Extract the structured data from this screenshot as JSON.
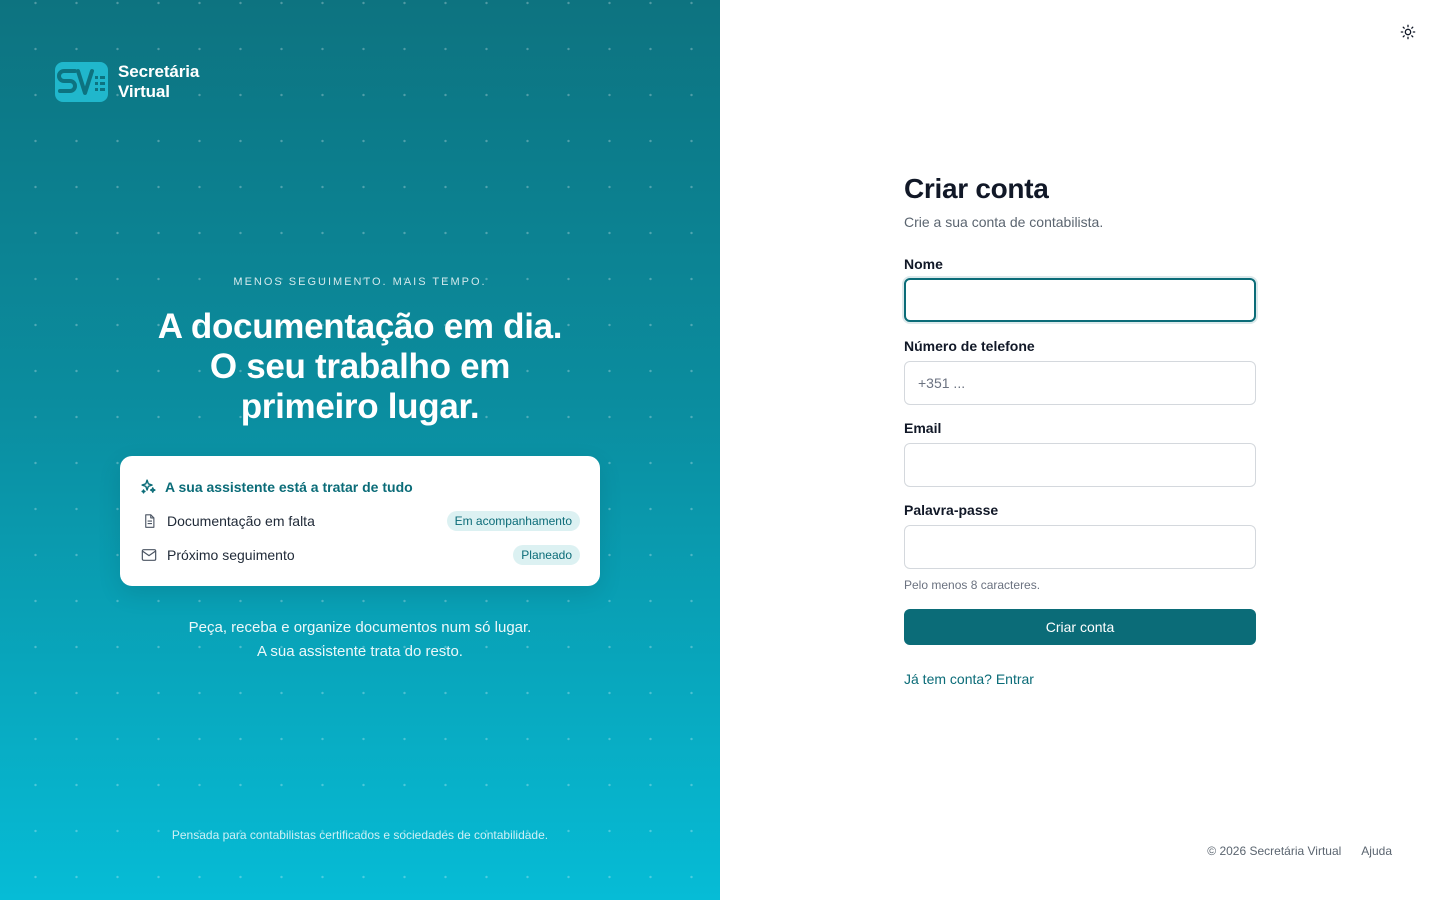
{
  "brand": {
    "name_line1": "Secretária",
    "name_line2": "Virtual",
    "logo_icon": "sv-logo-icon"
  },
  "hero": {
    "eyebrow": "MENOS SEGUIMENTO. MAIS TEMPO.",
    "headline_line1": "A documentação em dia.",
    "headline_line2": "O seu trabalho em",
    "headline_line3": "primeiro lugar.",
    "subtext_line1": "Peça, receba e organize documentos num só lugar.",
    "subtext_line2": "A sua assistente trata do resto.",
    "footnote": "Pensada para contabilistas certificados e sociedades de contabilidade."
  },
  "card": {
    "title": "A sua assistente está a tratar de tudo",
    "rows": [
      {
        "label": "Documentação em falta",
        "badge": "Em acompanhamento",
        "icon": "document-icon"
      },
      {
        "label": "Próximo seguimento",
        "badge": "Planeado",
        "icon": "mail-icon"
      }
    ]
  },
  "form": {
    "title": "Criar conta",
    "subtitle": "Crie a sua conta de contabilista.",
    "fields": {
      "name": {
        "label": "Nome",
        "value": "",
        "placeholder": ""
      },
      "phone": {
        "label": "Número de telefone",
        "value": "",
        "placeholder": "+351 ..."
      },
      "email": {
        "label": "Email",
        "value": "",
        "placeholder": ""
      },
      "password": {
        "label": "Palavra-passe",
        "value": "",
        "placeholder": "",
        "hint": "Pelo menos 8 caracteres."
      }
    },
    "submit_label": "Criar conta",
    "login_link": "Já tem conta? Entrar"
  },
  "footer": {
    "copyright": "© 2026 Secretária Virtual",
    "help": "Ajuda"
  },
  "colors": {
    "primary": "#0b6c78",
    "gradient_top": "#0d7380",
    "gradient_bottom": "#06bcd6"
  }
}
